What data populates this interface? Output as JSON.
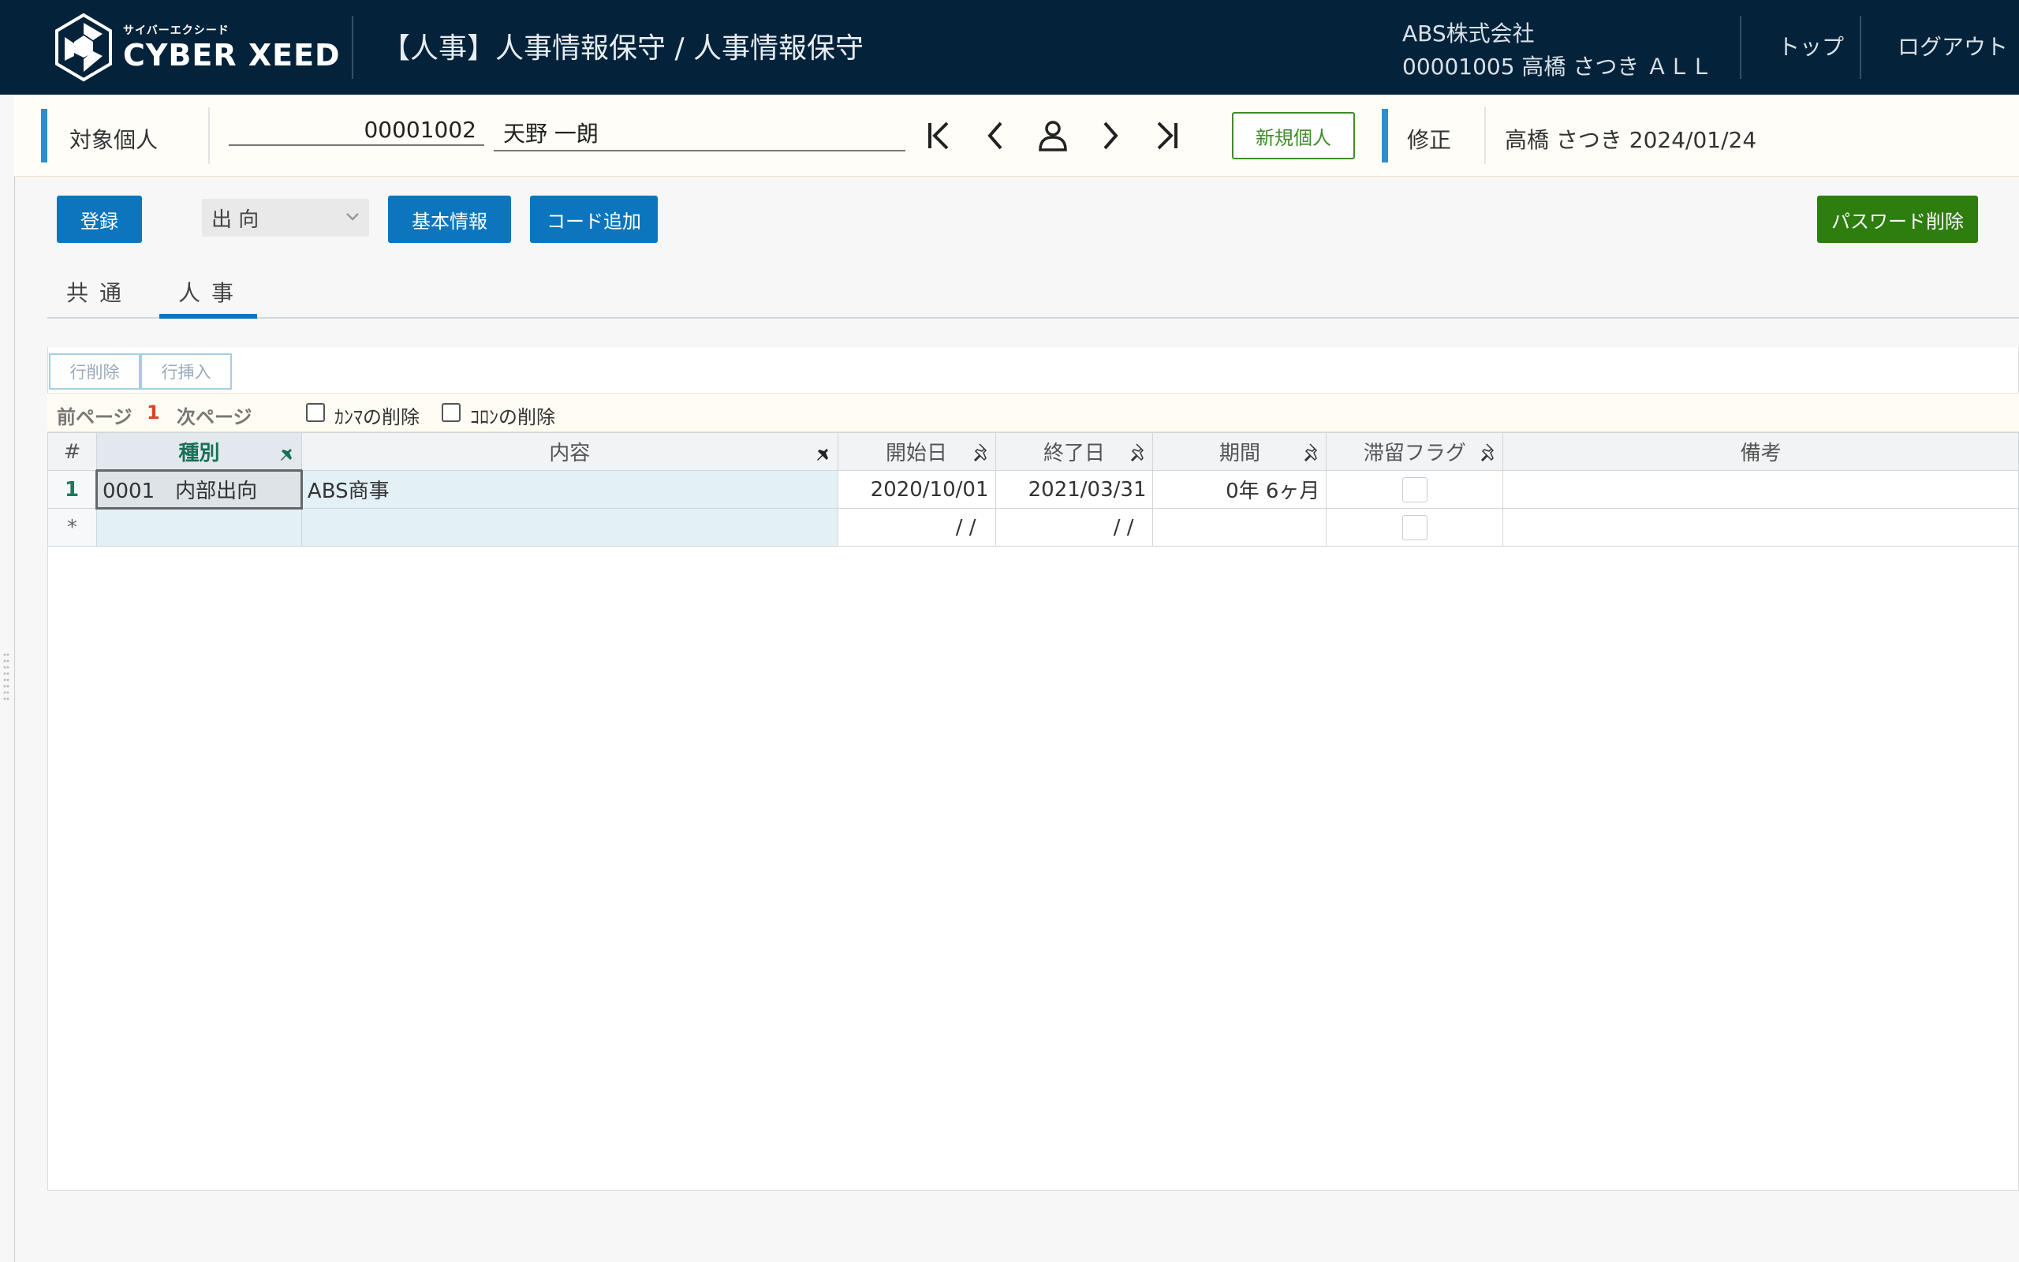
{
  "header": {
    "logo_sub": "サイバーエクシード",
    "logo_main": "CYBER XEED",
    "title": "【人事】人事情報保守 / 人事情報保守",
    "company": "ABS株式会社",
    "user": "00001005 高橋 さつき ＡＬＬ",
    "top_label": "トップ",
    "logout_label": "ログアウト"
  },
  "target": {
    "label": "対象個人",
    "code": "00001002",
    "name": "天野 一朗",
    "new_person_label": "新規個人",
    "mode_label": "修正",
    "modified_info": "高橋 さつき 2024/01/24"
  },
  "toolbar": {
    "register_label": "登録",
    "category_value": "出 向",
    "basic_info_label": "基本情報",
    "add_code_label": "コード追加",
    "delete_password_label": "パスワード削除"
  },
  "tabs": [
    {
      "label": "共通",
      "active": false
    },
    {
      "label": "人事",
      "active": true
    }
  ],
  "grid_tools": {
    "delete_row_label": "行削除",
    "insert_row_label": "行挿入"
  },
  "pager": {
    "prev_label": "前ページ",
    "page": "1",
    "next_label": "次ページ",
    "comma_delete_label": "ｶﾝﾏの削除",
    "colon_delete_label": "ｺﾛﾝの削除"
  },
  "columns": [
    "#",
    "種別",
    "内容",
    "開始日",
    "終了日",
    "期間",
    "滞留フラグ",
    "備考"
  ],
  "rows": [
    {
      "no": "1",
      "type": "0001　内部出向",
      "content": "ABS商事",
      "start": "2020/10/01",
      "end": "2021/03/31",
      "period": "0年 6ヶ月",
      "remarks": ""
    },
    {
      "no": "*",
      "type": "",
      "content": "",
      "start": "/ /",
      "end": "/ /",
      "period": "",
      "remarks": ""
    }
  ],
  "colors": {
    "header_bg": "#04233a",
    "primary_button": "#0b76bd",
    "danger_button": "#2e7d0f",
    "accent": "#2b8ed0"
  }
}
